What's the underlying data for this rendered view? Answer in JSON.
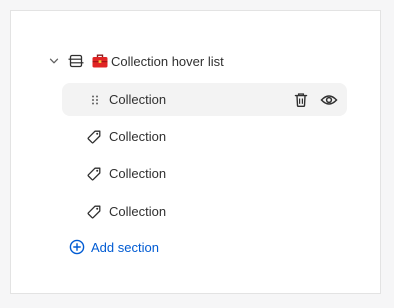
{
  "section": {
    "title": "Collection hover list"
  },
  "blocks": [
    {
      "label": "Collection",
      "state": "hovered"
    },
    {
      "label": "Collection"
    },
    {
      "label": "Collection"
    },
    {
      "label": "Collection"
    }
  ],
  "add_section": {
    "label": "Add section"
  },
  "colors": {
    "text": "#303030",
    "link": "#005bd3",
    "hover_bg": "#f3f3f3",
    "icon_red": "#e02424"
  },
  "icons": [
    "chevron-down-icon",
    "section-icon",
    "toolbox-icon",
    "drag-handle-icon",
    "trash-icon",
    "eye-icon",
    "tag-icon",
    "plus-circle-icon"
  ]
}
